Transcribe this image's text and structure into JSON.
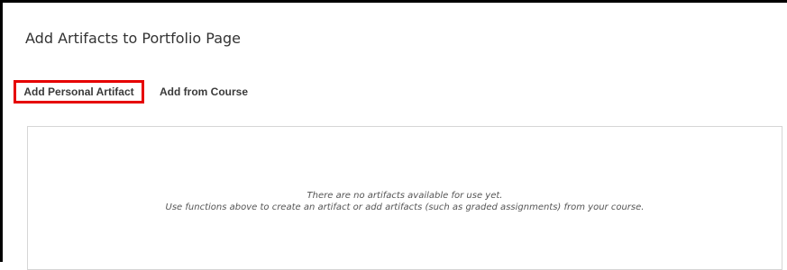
{
  "dialog": {
    "title": "Add Artifacts to Portfolio Page"
  },
  "tabs": [
    {
      "label": "Add Personal Artifact",
      "highlighted": true
    },
    {
      "label": "Add from Course",
      "highlighted": false
    }
  ],
  "empty_state": {
    "line1": "There are no artifacts available for use yet.",
    "line2": "Use functions above to create an artifact or add artifacts (such as graded assignments) from your course."
  },
  "colors": {
    "highlight_border": "#e60000",
    "panel_border": "#d6d6d6",
    "frame_border": "#000000"
  }
}
